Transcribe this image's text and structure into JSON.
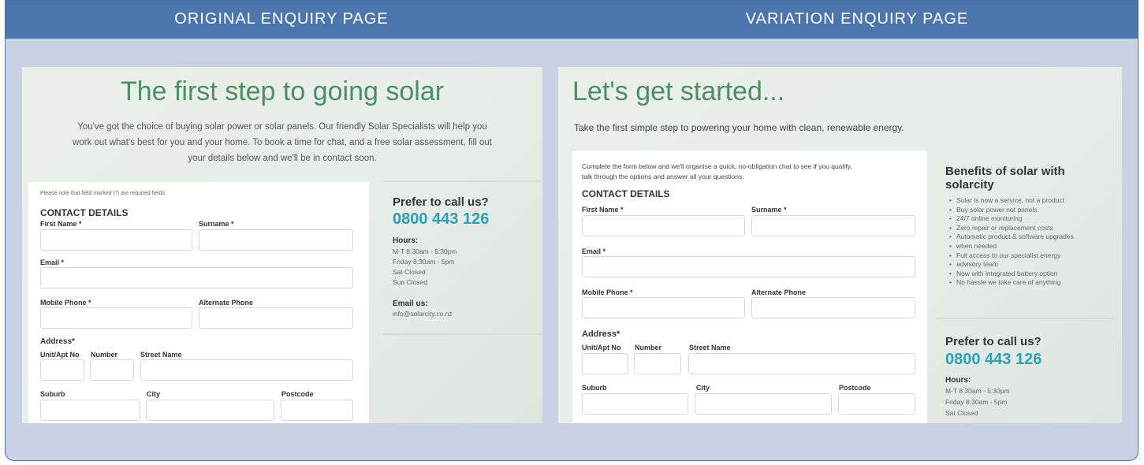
{
  "header": {
    "original_label": "ORIGINAL ENQUIRY PAGE",
    "variation_label": "VARIATION ENQUIRY PAGE"
  },
  "original": {
    "title": "The first step to going solar",
    "intro_line1": "You've got the choice of buying solar power or solar panels. Our friendly Solar Specialists will help you",
    "intro_line2": "work out what's best for you and your home. To book a time for chat, and a free solar assessment, fill out",
    "intro_line3": "your details below and we'll be in contact soon.",
    "required_note": "Please note that field marked (*) are required fields",
    "contact_heading": "CONTACT DETAILS",
    "first_name_label": "First Name *",
    "surname_label": "Surname *",
    "email_label": "Email *",
    "mobile_label": "Mobile Phone *",
    "alternate_label": "Alternate Phone",
    "address_label": "Address*",
    "unit_label": "Unit/Apt No",
    "number_label": "Number",
    "street_label": "Street Name",
    "suburb_label": "Suburb",
    "city_label": "City",
    "postcode_label": "Postcode",
    "call_heading": "Prefer to call us?",
    "phone": "0800 443 126",
    "hours_heading": "Hours:",
    "hours_mt": "M-T   8:30am - 5:30pm",
    "hours_fri": "Friday 8:30am - 5pm",
    "hours_sat": "Sat    Closed",
    "hours_sun": "Sun   Closed",
    "email_heading": "Email us:",
    "email_address": "info@solarcity.co.nz"
  },
  "variation": {
    "title": "Let's get started...",
    "intro": "Take the first simple step to powering your home with clean, renewable energy.",
    "form_intro_line1": "Complete the form below and we'll organise a quick, no-obligation chat to see if you qualify,",
    "form_intro_line2": "talk through the options and answer all your questions.",
    "contact_heading": "CONTACT DETAILS",
    "first_name_label": "First Name *",
    "surname_label": "Surname *",
    "email_label": "Email *",
    "mobile_label": "Mobile Phone *",
    "alternate_label": "Alternate Phone",
    "address_label": "Address*",
    "unit_label": "Unit/Apt No",
    "number_label": "Number",
    "street_label": "Street Name",
    "suburb_label": "Suburb",
    "city_label": "City",
    "postcode_label": "Postcode",
    "benefits_heading_line1": "Benefits of solar with",
    "benefits_heading_line2": "solarcity",
    "benefits": [
      "Solar is now a service, not a product",
      "Buy solar power not panels",
      "24/7 online monitoring",
      "Zero repair or replacement costs",
      "Automatic product & software upgrades",
      "when needed",
      "Full access to our specialist energy",
      "advisory team",
      "Now with integrated battery option",
      "No hassle we take care of anything"
    ],
    "call_heading": "Prefer to call us?",
    "phone": "0800 443 126",
    "hours_heading": "Hours:",
    "hours_mt": "M-T   8:30am - 5:30pm",
    "hours_fri": "Friday 8:30am - 5pm",
    "hours_sat": "Sat    Closed"
  },
  "colors": {
    "header_bar": "#4a76ad",
    "frame_bg": "#c8d2e3",
    "title_green": "#4c8f66",
    "phone_teal": "#29a1b8"
  }
}
